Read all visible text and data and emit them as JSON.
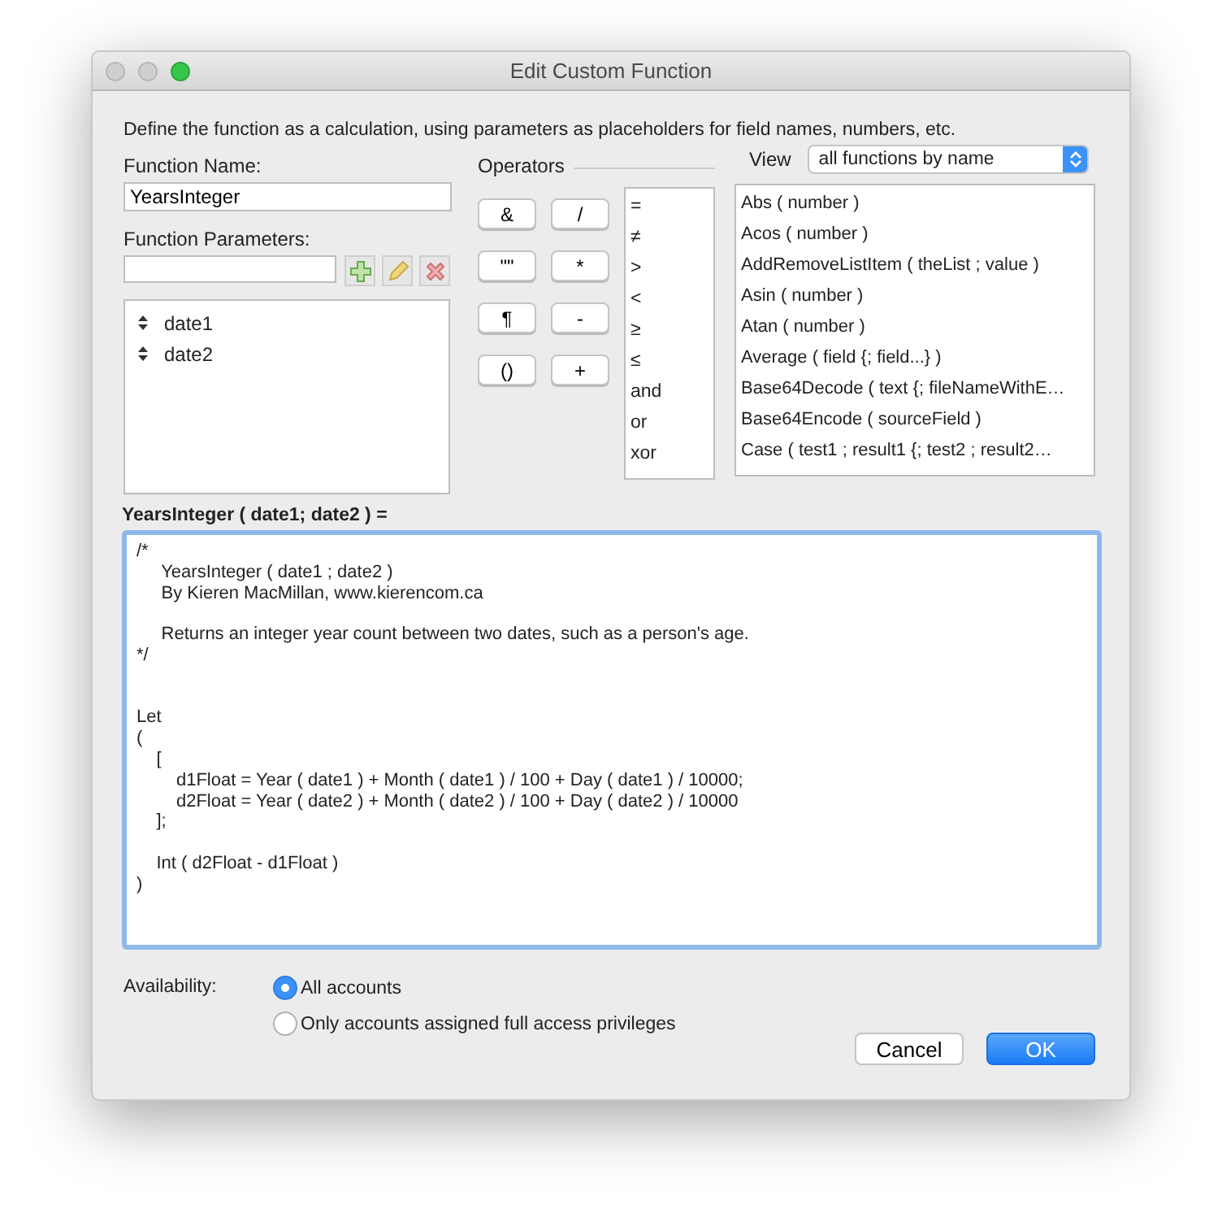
{
  "window": {
    "title": "Edit Custom Function"
  },
  "description": "Define the function as a calculation, using parameters as placeholders for field names, numbers, etc.",
  "function_name": {
    "label": "Function Name:",
    "value": "YearsInteger"
  },
  "parameters": {
    "label": "Function Parameters:",
    "items": [
      "date1",
      "date2"
    ]
  },
  "operators": {
    "label": "Operators",
    "buttons": [
      "&",
      "/",
      "\"\"",
      "*",
      "¶",
      "-",
      "()",
      "+"
    ],
    "list": [
      "=",
      "≠",
      ">",
      "<",
      "≥",
      "≤",
      "and",
      "or",
      "xor"
    ]
  },
  "view": {
    "label": "View",
    "value": "all functions by name"
  },
  "functions": [
    "Abs ( number )",
    "Acos ( number )",
    "AddRemoveListItem ( theList ; value )",
    "Asin ( number )",
    "Atan ( number )",
    "Average ( field {; field...} )",
    "Base64Decode ( text {; fileNameWithE…",
    "Base64Encode ( sourceField )",
    "Case ( test1 ; result1 {; test2 ; result2…"
  ],
  "formula": {
    "label": "YearsInteger ( date1; date2 ) =",
    "code": "/*\n\t YearsInteger ( date1 ; date2 )\n\t By Kieren MacMillan, www.kierencom.ca\n\n\t Returns an integer year count between two dates, such as a person's age.\n*/\n\n\nLet\n(\n\t[\n\t\td1Float = Year ( date1 ) + Month ( date1 ) / 100 + Day ( date1 ) / 10000;\n\t\td2Float = Year ( date2 ) + Month ( date2 ) / 100 + Day ( date2 ) / 10000\n\t];\n\n\tInt ( d2Float - d1Float )\n)"
  },
  "availability": {
    "label": "Availability:",
    "options": [
      {
        "label": "All accounts",
        "selected": true
      },
      {
        "label": "Only accounts assigned full access privileges",
        "selected": false
      }
    ]
  },
  "buttons": [
    {
      "label": "Cancel",
      "kind": "secondary"
    },
    {
      "label": "OK",
      "kind": "default"
    }
  ]
}
